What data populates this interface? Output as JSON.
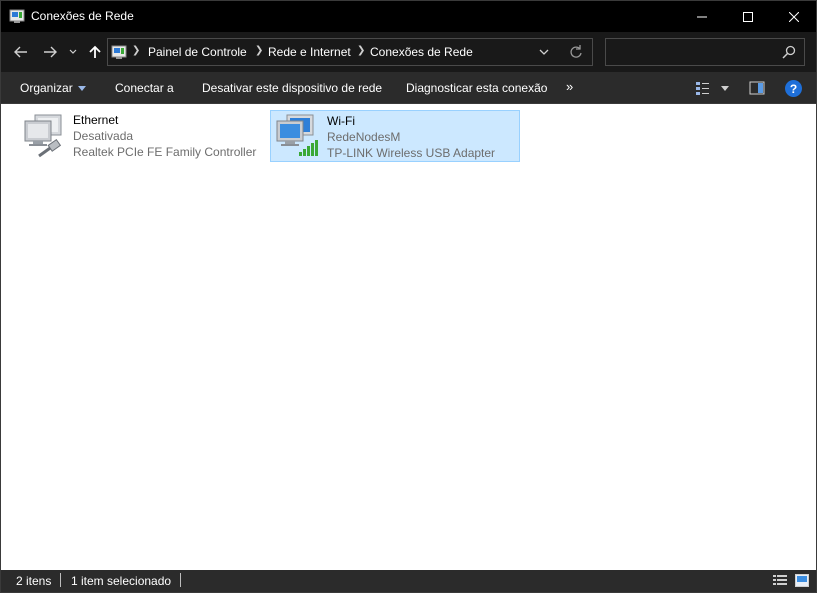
{
  "window": {
    "title": "Conexões de Rede",
    "minimize_icon": "minimize-icon",
    "maximize_icon": "maximize-icon",
    "close_icon": "close-icon"
  },
  "address": {
    "crumbs": [
      "Painel de Controle",
      "Rede e Internet",
      "Conexões de Rede"
    ],
    "search_placeholder": ""
  },
  "commands": {
    "organize": "Organizar",
    "connect": "Conectar a",
    "disable": "Desativar este dispositivo de rede",
    "diagnose": "Diagnosticar esta conexão",
    "more": "»",
    "help": "?"
  },
  "items": [
    {
      "name": "Ethernet",
      "status": "Desativada",
      "device": "Realtek PCIe FE Family Controller",
      "selected": false
    },
    {
      "name": "Wi-Fi",
      "status": "RedeNodesM",
      "device": "TP-LINK Wireless USB Adapter",
      "selected": true
    }
  ],
  "status": {
    "count": "2 itens",
    "selection": "1 item selecionado"
  },
  "colors": {
    "accent": "#1e6fd9",
    "selection_bg": "#cce8ff",
    "selection_border": "#99d1ff",
    "signal": "#3aa836"
  }
}
